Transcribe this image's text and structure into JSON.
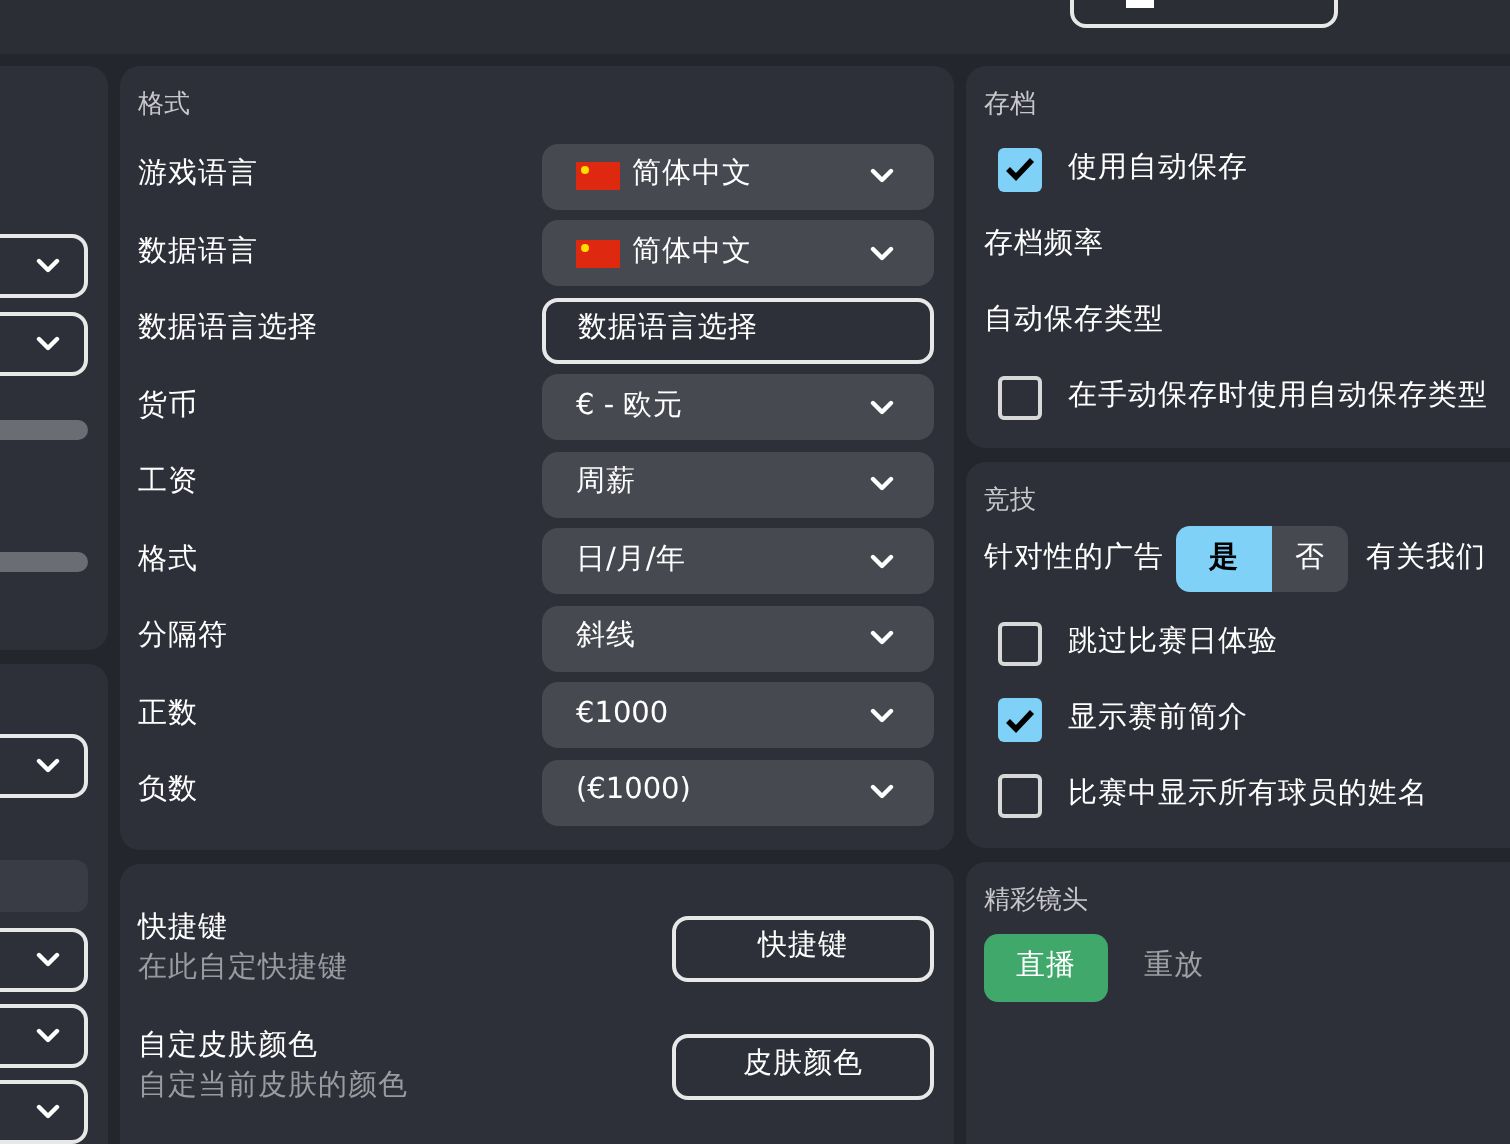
{
  "format": {
    "title": "格式",
    "rows": [
      {
        "kind": "dropdown",
        "label": "游戏语言",
        "value": "简体中文",
        "flag": true
      },
      {
        "kind": "dropdown",
        "label": "数据语言",
        "value": "简体中文",
        "flag": true
      },
      {
        "kind": "input",
        "label": "数据语言选择",
        "value": "数据语言选择"
      },
      {
        "kind": "dropdown",
        "label": "货币",
        "value": "€ - 欧元",
        "flag": false
      },
      {
        "kind": "dropdown",
        "label": "工资",
        "value": "周薪",
        "flag": false
      },
      {
        "kind": "dropdown",
        "label": "格式",
        "value": "日/月/年",
        "flag": false
      },
      {
        "kind": "dropdown",
        "label": "分隔符",
        "value": "斜线",
        "flag": false
      },
      {
        "kind": "dropdown",
        "label": "正数",
        "value": "€1000",
        "flag": false
      },
      {
        "kind": "dropdown",
        "label": "负数",
        "value": "(€1000)",
        "flag": false
      }
    ]
  },
  "customize": [
    {
      "title": "快捷键",
      "subtitle": "在此自定快捷键",
      "button": "快捷键"
    },
    {
      "title": "自定皮肤颜色",
      "subtitle": "自定当前皮肤的颜色",
      "button": "皮肤颜色"
    }
  ],
  "saving": {
    "title": "存档",
    "rows": [
      {
        "kind": "checkbox",
        "label": "使用自动保存",
        "checked": true
      },
      {
        "kind": "label",
        "label": "存档频率"
      },
      {
        "kind": "label",
        "label": "自动保存类型"
      },
      {
        "kind": "checkbox",
        "label": "在手动保存时使用自动保存类型",
        "checked": false
      }
    ]
  },
  "competition": {
    "title": "竞技",
    "ads": {
      "label": "针对性的广告",
      "options": [
        {
          "label": "是",
          "selected": true
        },
        {
          "label": "否",
          "selected": false
        }
      ],
      "link": "有关我们"
    },
    "checks": [
      {
        "label": "跳过比赛日体验",
        "checked": false
      },
      {
        "label": "显示赛前简介",
        "checked": true
      },
      {
        "label": "比赛中显示所有球员的姓名",
        "checked": false
      }
    ]
  },
  "highlights": {
    "title": "精彩镜头",
    "options": [
      {
        "label": "直播",
        "selected": true
      },
      {
        "label": "重放",
        "selected": false
      }
    ]
  }
}
